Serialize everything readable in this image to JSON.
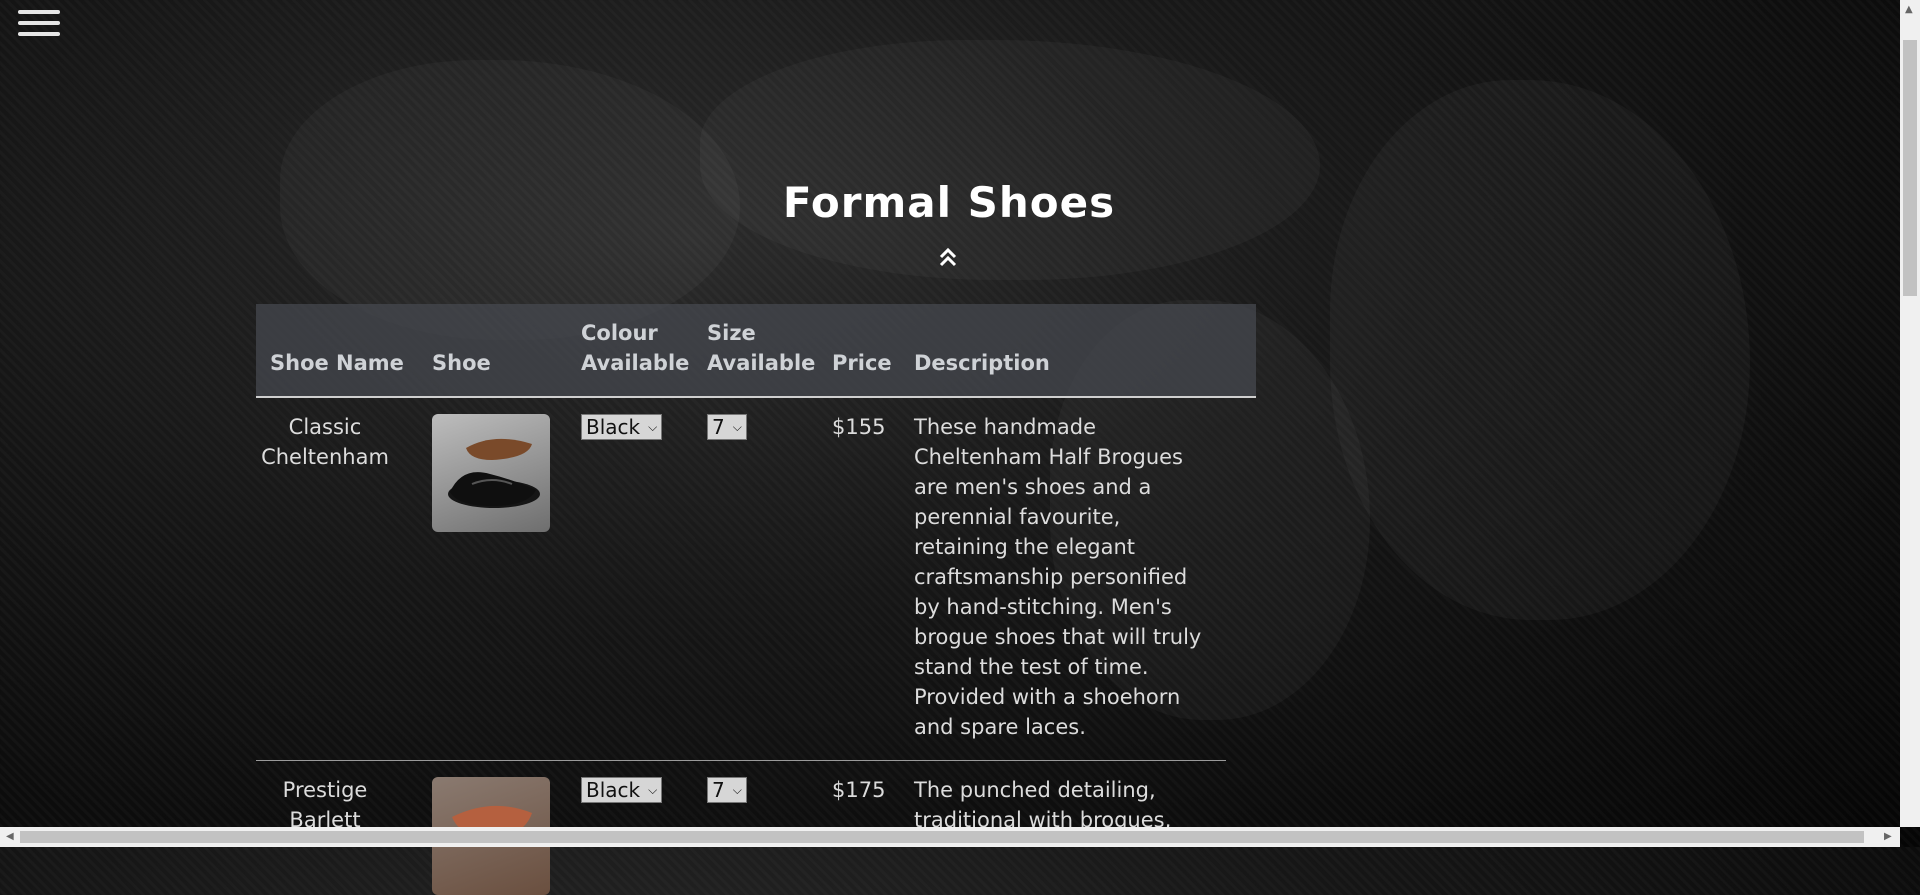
{
  "page": {
    "title": "Formal Shoes"
  },
  "icons": {
    "menu": "hamburger-menu-icon",
    "up": "double-chevron-up-icon"
  },
  "table": {
    "headers": {
      "name": "Shoe Name",
      "image": "Shoe",
      "colour_line1": "Colour",
      "colour_line2": "Available",
      "size_line1": "Size",
      "size_line2": "Available",
      "price": "Price",
      "description": "Description"
    },
    "rows": [
      {
        "name_line1": "Classic",
        "name_line2": "Cheltenham",
        "colour": "Black",
        "size": "7",
        "price": "$155",
        "description": "These handmade Cheltenham Half Brogues are men's shoes and a perennial favourite, retaining the elegant craftsmanship personified by hand-stitching. Men's brogue shoes that will truly stand the test of time. Provided with a shoehorn and spare laces."
      },
      {
        "name_line1": "Prestige",
        "name_line2": "Barlett",
        "colour": "Black",
        "size": "7",
        "price": "$175",
        "description": "The punched detailing, traditional with brogues,"
      }
    ]
  },
  "colors": {
    "background": "#0b0b0b",
    "header_bg": "#464a50",
    "text": "#d8d8d8"
  }
}
